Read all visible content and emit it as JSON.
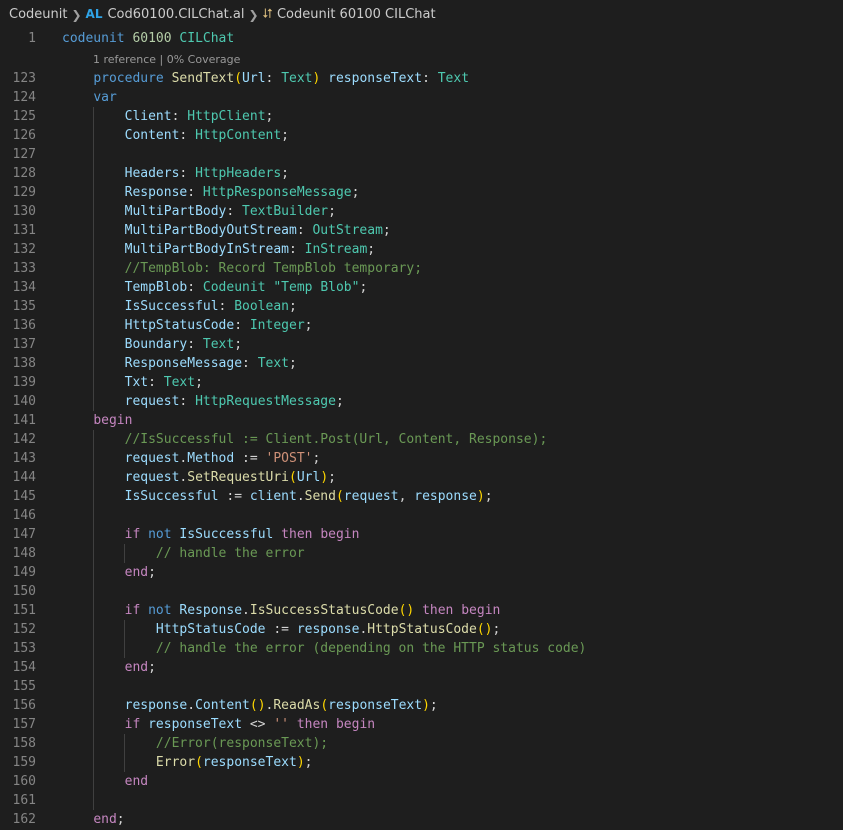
{
  "breadcrumb": {
    "folder": "Codeunit",
    "file_icon": "AL",
    "file": "Cod60100.CILChat.al",
    "symbol": "Codeunit 60100 CILChat"
  },
  "codelens": {
    "references": "1 reference",
    "separator": " | ",
    "coverage": "0% Coverage"
  },
  "lines": [
    {
      "n": "1",
      "tokens": [
        [
          "codeunit",
          "kw"
        ],
        [
          " ",
          "p"
        ],
        [
          "60100",
          "num"
        ],
        [
          " ",
          "p"
        ],
        [
          "CILChat",
          "type"
        ]
      ]
    },
    {
      "lens": true
    },
    {
      "n": "123",
      "tokens": [
        [
          "    ",
          "p"
        ],
        [
          "procedure",
          "kw"
        ],
        [
          " ",
          "p"
        ],
        [
          "SendText",
          "fn"
        ],
        [
          "(",
          "b1"
        ],
        [
          "Url",
          "var"
        ],
        [
          ": ",
          "p"
        ],
        [
          "Text",
          "type"
        ],
        [
          ")",
          "b1"
        ],
        [
          " ",
          "p"
        ],
        [
          "responseText",
          "var"
        ],
        [
          ": ",
          "p"
        ],
        [
          "Text",
          "type"
        ]
      ]
    },
    {
      "n": "124",
      "tokens": [
        [
          "    ",
          "p"
        ],
        [
          "var",
          "kw"
        ]
      ]
    },
    {
      "n": "125",
      "tokens": [
        [
          "        ",
          "p"
        ],
        [
          "Client",
          "var"
        ],
        [
          ": ",
          "p"
        ],
        [
          "HttpClient",
          "type"
        ],
        [
          ";",
          "p"
        ]
      ]
    },
    {
      "n": "126",
      "tokens": [
        [
          "        ",
          "p"
        ],
        [
          "Content",
          "var"
        ],
        [
          ": ",
          "p"
        ],
        [
          "HttpContent",
          "type"
        ],
        [
          ";",
          "p"
        ]
      ]
    },
    {
      "n": "127",
      "tokens": []
    },
    {
      "n": "128",
      "tokens": [
        [
          "        ",
          "p"
        ],
        [
          "Headers",
          "var"
        ],
        [
          ": ",
          "p"
        ],
        [
          "HttpHeaders",
          "type"
        ],
        [
          ";",
          "p"
        ]
      ]
    },
    {
      "n": "129",
      "tokens": [
        [
          "        ",
          "p"
        ],
        [
          "Response",
          "var"
        ],
        [
          ": ",
          "p"
        ],
        [
          "HttpResponseMessage",
          "type"
        ],
        [
          ";",
          "p"
        ]
      ]
    },
    {
      "n": "130",
      "tokens": [
        [
          "        ",
          "p"
        ],
        [
          "MultiPartBody",
          "var"
        ],
        [
          ": ",
          "p"
        ],
        [
          "TextBuilder",
          "type"
        ],
        [
          ";",
          "p"
        ]
      ]
    },
    {
      "n": "131",
      "tokens": [
        [
          "        ",
          "p"
        ],
        [
          "MultiPartBodyOutStream",
          "var"
        ],
        [
          ": ",
          "p"
        ],
        [
          "OutStream",
          "type"
        ],
        [
          ";",
          "p"
        ]
      ]
    },
    {
      "n": "132",
      "tokens": [
        [
          "        ",
          "p"
        ],
        [
          "MultiPartBodyInStream",
          "var"
        ],
        [
          ": ",
          "p"
        ],
        [
          "InStream",
          "type"
        ],
        [
          ";",
          "p"
        ]
      ]
    },
    {
      "n": "133",
      "tokens": [
        [
          "        ",
          "p"
        ],
        [
          "//TempBlob: Record TempBlob temporary;",
          "cmt"
        ]
      ]
    },
    {
      "n": "134",
      "tokens": [
        [
          "        ",
          "p"
        ],
        [
          "TempBlob",
          "var"
        ],
        [
          ": ",
          "p"
        ],
        [
          "Codeunit",
          "type"
        ],
        [
          " ",
          "p"
        ],
        [
          "\"Temp Blob\"",
          "type"
        ],
        [
          ";",
          "p"
        ]
      ]
    },
    {
      "n": "135",
      "tokens": [
        [
          "        ",
          "p"
        ],
        [
          "IsSuccessful",
          "var"
        ],
        [
          ": ",
          "p"
        ],
        [
          "Boolean",
          "type"
        ],
        [
          ";",
          "p"
        ]
      ]
    },
    {
      "n": "136",
      "tokens": [
        [
          "        ",
          "p"
        ],
        [
          "HttpStatusCode",
          "var"
        ],
        [
          ": ",
          "p"
        ],
        [
          "Integer",
          "type"
        ],
        [
          ";",
          "p"
        ]
      ]
    },
    {
      "n": "137",
      "tokens": [
        [
          "        ",
          "p"
        ],
        [
          "Boundary",
          "var"
        ],
        [
          ": ",
          "p"
        ],
        [
          "Text",
          "type"
        ],
        [
          ";",
          "p"
        ]
      ]
    },
    {
      "n": "138",
      "tokens": [
        [
          "        ",
          "p"
        ],
        [
          "ResponseMessage",
          "var"
        ],
        [
          ": ",
          "p"
        ],
        [
          "Text",
          "type"
        ],
        [
          ";",
          "p"
        ]
      ]
    },
    {
      "n": "139",
      "tokens": [
        [
          "        ",
          "p"
        ],
        [
          "Txt",
          "var"
        ],
        [
          ": ",
          "p"
        ],
        [
          "Text",
          "type"
        ],
        [
          ";",
          "p"
        ]
      ]
    },
    {
      "n": "140",
      "tokens": [
        [
          "        ",
          "p"
        ],
        [
          "request",
          "var"
        ],
        [
          ": ",
          "p"
        ],
        [
          "HttpRequestMessage",
          "type"
        ],
        [
          ";",
          "p"
        ]
      ]
    },
    {
      "n": "141",
      "tokens": [
        [
          "    ",
          "p"
        ],
        [
          "begin",
          "ctl"
        ]
      ]
    },
    {
      "n": "142",
      "tokens": [
        [
          "        ",
          "p"
        ],
        [
          "//IsSuccessful := Client.Post(Url, Content, Response);",
          "cmt"
        ]
      ]
    },
    {
      "n": "143",
      "tokens": [
        [
          "        ",
          "p"
        ],
        [
          "request",
          "var"
        ],
        [
          ".",
          "p"
        ],
        [
          "Method",
          "var"
        ],
        [
          " := ",
          "p"
        ],
        [
          "'POST'",
          "str"
        ],
        [
          ";",
          "p"
        ]
      ]
    },
    {
      "n": "144",
      "tokens": [
        [
          "        ",
          "p"
        ],
        [
          "request",
          "var"
        ],
        [
          ".",
          "p"
        ],
        [
          "SetRequestUri",
          "fn"
        ],
        [
          "(",
          "b1"
        ],
        [
          "Url",
          "var"
        ],
        [
          ")",
          "b1"
        ],
        [
          ";",
          "p"
        ]
      ]
    },
    {
      "n": "145",
      "tokens": [
        [
          "        ",
          "p"
        ],
        [
          "IsSuccessful",
          "var"
        ],
        [
          " := ",
          "p"
        ],
        [
          "client",
          "var"
        ],
        [
          ".",
          "p"
        ],
        [
          "Send",
          "fn"
        ],
        [
          "(",
          "b1"
        ],
        [
          "request",
          "var"
        ],
        [
          ", ",
          "p"
        ],
        [
          "response",
          "var"
        ],
        [
          ")",
          "b1"
        ],
        [
          ";",
          "p"
        ]
      ]
    },
    {
      "n": "146",
      "tokens": []
    },
    {
      "n": "147",
      "tokens": [
        [
          "        ",
          "p"
        ],
        [
          "if",
          "ctl"
        ],
        [
          " ",
          "p"
        ],
        [
          "not",
          "kw"
        ],
        [
          " ",
          "p"
        ],
        [
          "IsSuccessful",
          "var"
        ],
        [
          " ",
          "p"
        ],
        [
          "then",
          "ctl"
        ],
        [
          " ",
          "p"
        ],
        [
          "begin",
          "ctl"
        ]
      ]
    },
    {
      "n": "148",
      "tokens": [
        [
          "            ",
          "p"
        ],
        [
          "// handle the error",
          "cmt"
        ]
      ]
    },
    {
      "n": "149",
      "tokens": [
        [
          "        ",
          "p"
        ],
        [
          "end",
          "ctl"
        ],
        [
          ";",
          "p"
        ]
      ]
    },
    {
      "n": "150",
      "tokens": []
    },
    {
      "n": "151",
      "tokens": [
        [
          "        ",
          "p"
        ],
        [
          "if",
          "ctl"
        ],
        [
          " ",
          "p"
        ],
        [
          "not",
          "kw"
        ],
        [
          " ",
          "p"
        ],
        [
          "Response",
          "var"
        ],
        [
          ".",
          "p"
        ],
        [
          "IsSuccessStatusCode",
          "fn"
        ],
        [
          "()",
          "b1"
        ],
        [
          " ",
          "p"
        ],
        [
          "then",
          "ctl"
        ],
        [
          " ",
          "p"
        ],
        [
          "begin",
          "ctl"
        ]
      ]
    },
    {
      "n": "152",
      "tokens": [
        [
          "            ",
          "p"
        ],
        [
          "HttpStatusCode",
          "var"
        ],
        [
          " := ",
          "p"
        ],
        [
          "response",
          "var"
        ],
        [
          ".",
          "p"
        ],
        [
          "HttpStatusCode",
          "fn"
        ],
        [
          "()",
          "b1"
        ],
        [
          ";",
          "p"
        ]
      ]
    },
    {
      "n": "153",
      "tokens": [
        [
          "            ",
          "p"
        ],
        [
          "// handle the error (depending on the HTTP status code)",
          "cmt"
        ]
      ]
    },
    {
      "n": "154",
      "tokens": [
        [
          "        ",
          "p"
        ],
        [
          "end",
          "ctl"
        ],
        [
          ";",
          "p"
        ]
      ]
    },
    {
      "n": "155",
      "tokens": []
    },
    {
      "n": "156",
      "tokens": [
        [
          "        ",
          "p"
        ],
        [
          "response",
          "var"
        ],
        [
          ".",
          "p"
        ],
        [
          "Content",
          "var"
        ],
        [
          "()",
          "b1"
        ],
        [
          ".",
          "p"
        ],
        [
          "ReadAs",
          "fn"
        ],
        [
          "(",
          "b1"
        ],
        [
          "responseText",
          "var"
        ],
        [
          ")",
          "b1"
        ],
        [
          ";",
          "p"
        ]
      ]
    },
    {
      "n": "157",
      "tokens": [
        [
          "        ",
          "p"
        ],
        [
          "if",
          "ctl"
        ],
        [
          " ",
          "p"
        ],
        [
          "responseText",
          "var"
        ],
        [
          " <> ",
          "p"
        ],
        [
          "''",
          "str"
        ],
        [
          " ",
          "p"
        ],
        [
          "then",
          "ctl"
        ],
        [
          " ",
          "p"
        ],
        [
          "begin",
          "ctl"
        ]
      ]
    },
    {
      "n": "158",
      "tokens": [
        [
          "            ",
          "p"
        ],
        [
          "//Error(responseText);",
          "cmt"
        ]
      ]
    },
    {
      "n": "159",
      "tokens": [
        [
          "            ",
          "p"
        ],
        [
          "Error",
          "fn"
        ],
        [
          "(",
          "b1"
        ],
        [
          "responseText",
          "var"
        ],
        [
          ")",
          "b1"
        ],
        [
          ";",
          "p"
        ]
      ]
    },
    {
      "n": "160",
      "tokens": [
        [
          "        ",
          "p"
        ],
        [
          "end",
          "ctl"
        ]
      ]
    },
    {
      "n": "161",
      "tokens": []
    },
    {
      "n": "162",
      "tokens": [
        [
          "    ",
          "p"
        ],
        [
          "end",
          "ctl"
        ],
        [
          ";",
          "p"
        ]
      ]
    }
  ]
}
